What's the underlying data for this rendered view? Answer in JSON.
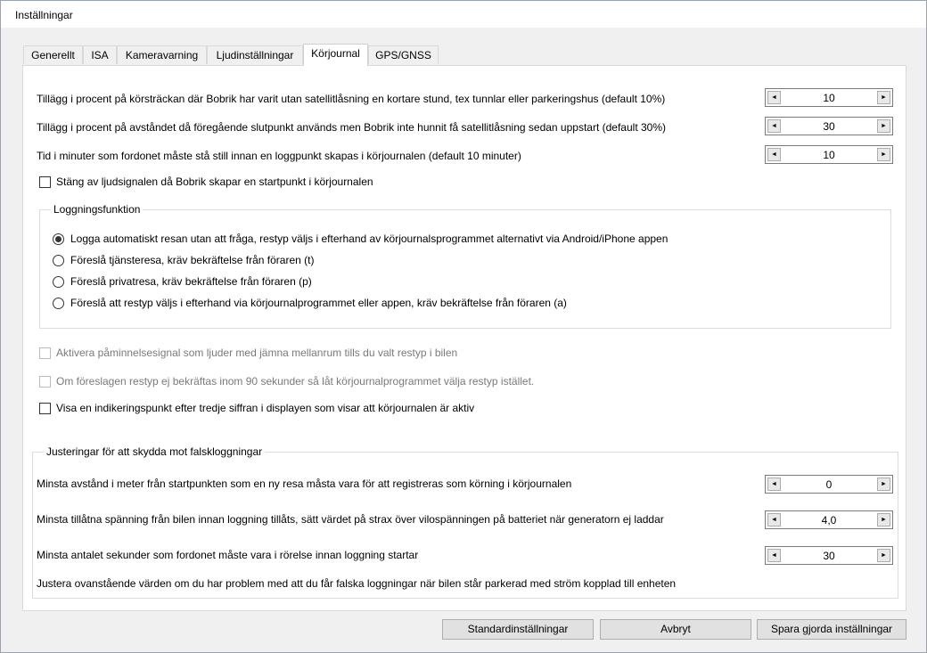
{
  "window": {
    "title": "Inställningar"
  },
  "tabs": [
    {
      "label": "Generellt"
    },
    {
      "label": "ISA"
    },
    {
      "label": "Kameravarning"
    },
    {
      "label": "Ljudinställningar"
    },
    {
      "label": "Körjournal"
    },
    {
      "label": "GPS/GNSS"
    }
  ],
  "settings": {
    "tunnel_label": "Tillägg i procent på körsträckan där Bobrik har varit utan satellitlåsning en kortare stund, tex tunnlar eller parkeringshus (default 10%)",
    "tunnel_value": "10",
    "endpoint_label": "Tillägg i procent på avståndet då föregående slutpunkt används men Bobrik inte hunnit få satellitlåsning sedan uppstart (default 30%)",
    "endpoint_value": "30",
    "still_label": "Tid i minuter som fordonet måste stå still innan en loggpunkt skapas i körjournalen (default 10 minuter)",
    "still_value": "10",
    "mute_start_label": "Stäng av ljudsignalen då Bobrik skapar en startpunkt i körjournalen"
  },
  "logging": {
    "legend": "Loggningsfunktion",
    "options": [
      {
        "label": "Logga automatiskt resan utan att fråga, restyp väljs i efterhand av körjournalsprogrammet alternativt via Android/iPhone appen",
        "selected": true
      },
      {
        "label": "Föreslå tjänsteresa, kräv bekräftelse från föraren (t)",
        "selected": false
      },
      {
        "label": "Föreslå privatresa, kräv bekräftelse från föraren (p)",
        "selected": false
      },
      {
        "label": "Föreslå att restyp väljs i efterhand via körjournalprogrammet eller appen, kräv bekräftelse från föraren (a)",
        "selected": false
      }
    ]
  },
  "options": {
    "reminder_label": "Aktivera påminnelsesignal som ljuder med jämna mellanrum tills du valt restyp i bilen",
    "timeout_label": "Om föreslagen restyp ej bekräftas inom 90 sekunder så låt körjournalprogrammet välja restyp istället.",
    "indicator_label": "Visa en indikeringspunkt efter tredje siffran i displayen som visar att körjournalen är aktiv"
  },
  "protection": {
    "legend": "Justeringar för att skydda mot falskloggningar",
    "distance_label": "Minsta avstånd i meter från startpunkten som en ny resa måsta vara för att registreras som körning i körjournalen",
    "distance_value": "0",
    "voltage_label": "Minsta tillåtna spänning från bilen innan loggning tillåts, sätt värdet på strax över vilospänningen på batteriet när generatorn ej laddar",
    "voltage_value": "4,0",
    "seconds_label": "Minsta antalet sekunder som fordonet måste vara i rörelse innan loggning startar",
    "seconds_value": "30",
    "note": "Justera ovanstående värden om du har problem med att du får falska loggningar när bilen står parkerad med ström kopplad till enheten"
  },
  "buttons": {
    "defaults": "Standardinställningar",
    "cancel": "Avbryt",
    "save": "Spara gjorda inställningar"
  },
  "icons": {
    "spin_left": "◄",
    "spin_right": "►"
  }
}
